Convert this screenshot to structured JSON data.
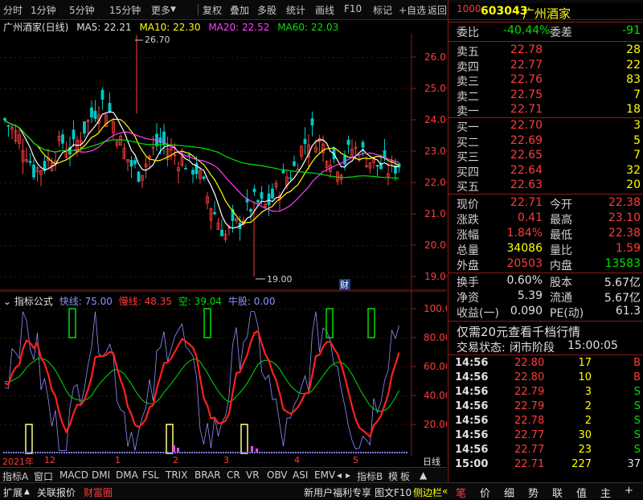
{
  "toolbar": {
    "items": [
      "分时",
      "1分钟",
      "5分钟",
      "15分钟",
      "更多",
      "复权",
      "叠加",
      "多股",
      "统计",
      "画线",
      "F10",
      "标记",
      "+自选",
      "返回"
    ]
  },
  "chart": {
    "title": "广州酒家(日线)",
    "ma5": "MA5: 22.21",
    "ma10": "MA10: 22.30",
    "ma20": "MA20: 22.52",
    "ma60": "MA60: 22.03",
    "price_axis": [
      "26.00",
      "25.00",
      "24.00",
      "23.00",
      "22.00",
      "21.00",
      "20.00",
      "19.00"
    ],
    "high_label": "26.70",
    "low_label": "19.00",
    "cai_label": "财",
    "colors": {
      "ma5": "#ffffff",
      "ma10": "#ffff00",
      "ma20": "#ff40ff",
      "ma60": "#00e000",
      "up": "#ff3b3b",
      "down": "#00c8c8"
    }
  },
  "indicator": {
    "name": "指标公式",
    "fast": "快线: 75.00",
    "slow": "慢线: 48.35",
    "empty": "空: 39.04",
    "bull": "牛股: 0.00",
    "axis": [
      "100.00",
      "80.00",
      "60.00",
      "40.00",
      "20.00"
    ]
  },
  "date_axis": {
    "labels": [
      "2021年",
      "12",
      "1",
      "2",
      "3",
      "4",
      "5"
    ],
    "right_label": "日线"
  },
  "tabs1": [
    "指标A",
    "窗口",
    "MACD",
    "DMI",
    "DMA",
    "FSL",
    "TRIX",
    "BRAR",
    "CR",
    "VR",
    "OBV",
    "ASI",
    "EMV",
    "指标B",
    "模",
    "板"
  ],
  "tabs2": {
    "left": [
      "扩展",
      "关联报价",
      "财富圈"
    ],
    "middle": [
      "新用户福利专享",
      "图文F10",
      "侧边栏"
    ],
    "icons": [
      "笔",
      "价",
      "细",
      "势",
      "联",
      "值",
      "主",
      "+"
    ]
  },
  "quote": {
    "code": "603043",
    "name": "广州酒家",
    "weibi_label": "委比",
    "weibi": "-40.44%",
    "weicha_label": "委差",
    "weicha": "-91",
    "sells": [
      {
        "label": "卖五",
        "price": "22.78",
        "vol": "28"
      },
      {
        "label": "卖四",
        "price": "22.77",
        "vol": "22"
      },
      {
        "label": "卖三",
        "price": "22.76",
        "vol": "83"
      },
      {
        "label": "卖二",
        "price": "22.75",
        "vol": "7"
      },
      {
        "label": "卖一",
        "price": "22.71",
        "vol": "18"
      }
    ],
    "buys": [
      {
        "label": "买一",
        "price": "22.70",
        "vol": "3"
      },
      {
        "label": "买二",
        "price": "22.69",
        "vol": "5"
      },
      {
        "label": "买三",
        "price": "22.65",
        "vol": "7"
      },
      {
        "label": "买四",
        "price": "22.64",
        "vol": "32"
      },
      {
        "label": "买五",
        "price": "22.63",
        "vol": "20"
      }
    ],
    "stats": [
      {
        "l1": "现价",
        "v1": "22.71",
        "l2": "今开",
        "v2": "22.38"
      },
      {
        "l1": "涨跌",
        "v1": "0.41",
        "l2": "最高",
        "v2": "23.10"
      },
      {
        "l1": "涨幅",
        "v1": "1.84%",
        "l2": "最低",
        "v2": "22.38"
      },
      {
        "l1": "总量",
        "v1": "34086",
        "l2": "量比",
        "v2": "1.59"
      },
      {
        "l1": "外盘",
        "v1": "20503",
        "l2": "内盘",
        "v2": "13583"
      }
    ],
    "stats2": [
      {
        "l1": "换手",
        "v1": "0.60%",
        "l2": "股本",
        "v2": "5.67亿"
      },
      {
        "l1": "净资",
        "v1": "5.39",
        "l2": "流通",
        "v2": "5.67亿"
      },
      {
        "l1": "收益(一)",
        "v1": "0.090",
        "l2": "PE(动)",
        "v2": "61.3"
      }
    ],
    "promo": "仅需20元查看千档行情",
    "trade_status_label": "交易状态:",
    "trade_status": "闭市阶段",
    "trade_time": "15:00:05",
    "ticks": [
      {
        "t": "14:56",
        "p": "22.80",
        "v": "17",
        "d": "B"
      },
      {
        "t": "14:56",
        "p": "22.80",
        "v": "10",
        "d": "B"
      },
      {
        "t": "14:56",
        "p": "22.79",
        "v": "3",
        "d": "S"
      },
      {
        "t": "14:56",
        "p": "22.79",
        "v": "2",
        "d": "S"
      },
      {
        "t": "14:56",
        "p": "22.78",
        "v": "2",
        "d": "S"
      },
      {
        "t": "14:56",
        "p": "22.77",
        "v": "30",
        "d": "S"
      },
      {
        "t": "14:56",
        "p": "22.77",
        "v": "23",
        "d": "S"
      },
      {
        "t": "15:00",
        "p": "22.71",
        "v": "227",
        "d": "37"
      }
    ]
  }
}
